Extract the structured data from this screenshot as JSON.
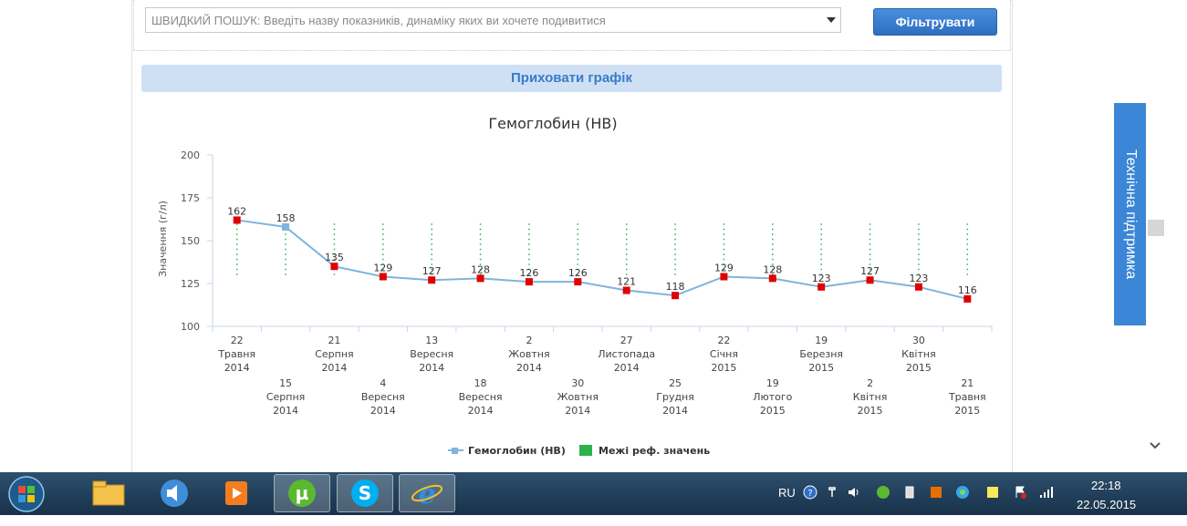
{
  "search": {
    "placeholder": "ШВИДКИЙ ПОШУК: Введіть назву показників, динаміку яких ви хочете подивитися",
    "filter_label": "Фільтрувати"
  },
  "toggle_chart_label": "Приховати графік",
  "support_tab_label": "Технічна підтримка",
  "taskbar": {
    "lang": "RU",
    "time": "22:18",
    "date": "22.05.2015"
  },
  "colors": {
    "series_line": "#7fb4dc",
    "series_marker": "#e00000",
    "ref_range": "#2ab24b",
    "accent": "#3b86d6"
  },
  "chart_data": {
    "type": "line",
    "title": "Гемоглобин (HB)",
    "ylabel": "Значення (г/л)",
    "xlabel": "",
    "ylim": [
      100,
      200
    ],
    "yticks": [
      100,
      125,
      150,
      175,
      200
    ],
    "grid": false,
    "legend_position": "bottom-center",
    "x": [
      [
        "22",
        "Травня",
        "2014"
      ],
      [
        "15",
        "Серпня",
        "2014"
      ],
      [
        "21",
        "Серпня",
        "2014"
      ],
      [
        "4",
        "Вересня",
        "2014"
      ],
      [
        "13",
        "Вересня",
        "2014"
      ],
      [
        "18",
        "Вересня",
        "2014"
      ],
      [
        "2",
        "Жовтня",
        "2014"
      ],
      [
        "30",
        "Жовтня",
        "2014"
      ],
      [
        "27",
        "Листопада",
        "2014"
      ],
      [
        "25",
        "Грудня",
        "2014"
      ],
      [
        "22",
        "Січня",
        "2015"
      ],
      [
        "19",
        "Лютого",
        "2015"
      ],
      [
        "19",
        "Березня",
        "2015"
      ],
      [
        "2",
        "Квітня",
        "2015"
      ],
      [
        "30",
        "Квітня",
        "2015"
      ],
      [
        "21",
        "Травня",
        "2015"
      ]
    ],
    "series": [
      {
        "name": "Гемоглобин (HB)",
        "values": [
          162,
          158,
          135,
          129,
          127,
          128,
          126,
          126,
          121,
          118,
          129,
          128,
          123,
          127,
          123,
          116
        ]
      },
      {
        "name": "Межі реф. значень",
        "low": [
          130,
          130,
          130,
          130,
          130,
          130,
          130,
          130,
          130,
          130,
          130,
          130,
          130,
          130,
          130,
          130
        ],
        "high": [
          160,
          160,
          160,
          160,
          160,
          160,
          160,
          160,
          160,
          160,
          160,
          160,
          160,
          160,
          160,
          160
        ]
      }
    ]
  }
}
